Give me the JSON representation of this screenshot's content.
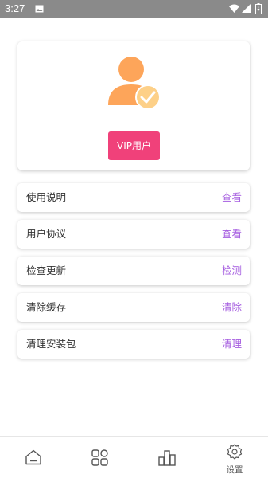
{
  "status_bar": {
    "time": "3:27",
    "icons": [
      "image-icon",
      "wifi-icon",
      "signal-icon",
      "battery-icon"
    ]
  },
  "profile": {
    "avatar_icon": "user-verified-icon",
    "vip_label": "VIP用户",
    "vip_color": "#f0417a",
    "avatar_color": "#fda55a",
    "badge_color": "#fdd088"
  },
  "menu": [
    {
      "label": "使用说明",
      "action": "查看"
    },
    {
      "label": "用户协议",
      "action": "查看"
    },
    {
      "label": "检查更新",
      "action": "检测"
    },
    {
      "label": "清除缓存",
      "action": "清除"
    },
    {
      "label": "清理安装包",
      "action": "清理"
    }
  ],
  "accent_color": "#a65ee0",
  "bottom_nav": {
    "items": [
      {
        "icon": "home-icon",
        "label": ""
      },
      {
        "icon": "apps-icon",
        "label": ""
      },
      {
        "icon": "stats-icon",
        "label": ""
      },
      {
        "icon": "settings-icon",
        "label": "设置"
      }
    ],
    "active_index": 3
  }
}
